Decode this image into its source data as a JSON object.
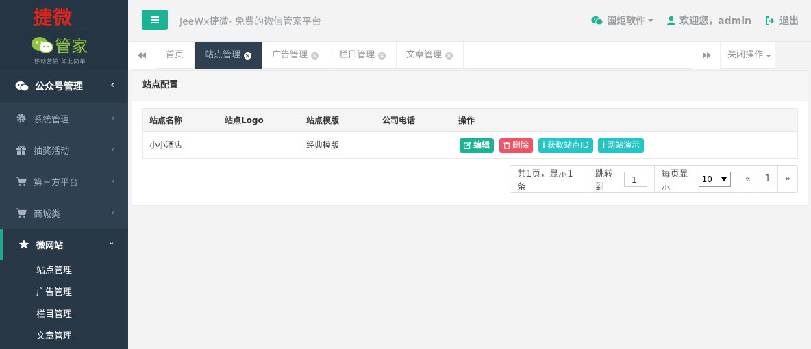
{
  "logo": {
    "title": "捷微",
    "subtitle": "管家",
    "slogan": "移动营销  如此简单"
  },
  "sidebar": {
    "top_item": {
      "label": "公众号管理",
      "icon": "wechat-icon"
    },
    "items": [
      {
        "label": "系统管理",
        "icon": "gear-icon"
      },
      {
        "label": "抽奖活动",
        "icon": "gift-icon"
      },
      {
        "label": "第三方平台",
        "icon": "cart-icon"
      },
      {
        "label": "商城类",
        "icon": "cart-icon"
      }
    ],
    "active_item": {
      "label": "微网站",
      "icon": "star-icon"
    },
    "submenu": [
      "站点管理",
      "广告管理",
      "栏目管理",
      "文章管理"
    ]
  },
  "header": {
    "title": "JeeWx捷微- 免费的微信管家平台",
    "company": "国炬软件",
    "welcome": "欢迎您，admin",
    "logout": "退出"
  },
  "tabs": {
    "items": [
      {
        "label": "首页",
        "closable": false,
        "active": false
      },
      {
        "label": "站点管理",
        "closable": true,
        "active": true
      },
      {
        "label": "广告管理",
        "closable": true,
        "active": false
      },
      {
        "label": "栏目管理",
        "closable": true,
        "active": false
      },
      {
        "label": "文章管理",
        "closable": true,
        "active": false
      }
    ],
    "close_ops": "关闭操作"
  },
  "panel": {
    "title": "站点配置",
    "columns": [
      "站点名称",
      "站点Logo",
      "站点模版",
      "公司电话",
      "操作"
    ],
    "rows": [
      {
        "name": "小小酒店",
        "logo": "",
        "template": "经典模版",
        "phone": ""
      }
    ],
    "actions": {
      "edit": "编辑",
      "delete": "删除",
      "get_id": "获取站点ID",
      "demo": "网站演示"
    }
  },
  "pager": {
    "summary": "共1页，显示1条",
    "jump_label": "跳转到",
    "jump_value": "1",
    "per_page_label": "每页显示",
    "per_page_value": "10",
    "prev": "«",
    "current": "1",
    "next": "»"
  },
  "colors": {
    "accent": "#1ab394",
    "danger": "#ed5565",
    "info": "#23c6c8",
    "sidebar": "#2f4050"
  }
}
